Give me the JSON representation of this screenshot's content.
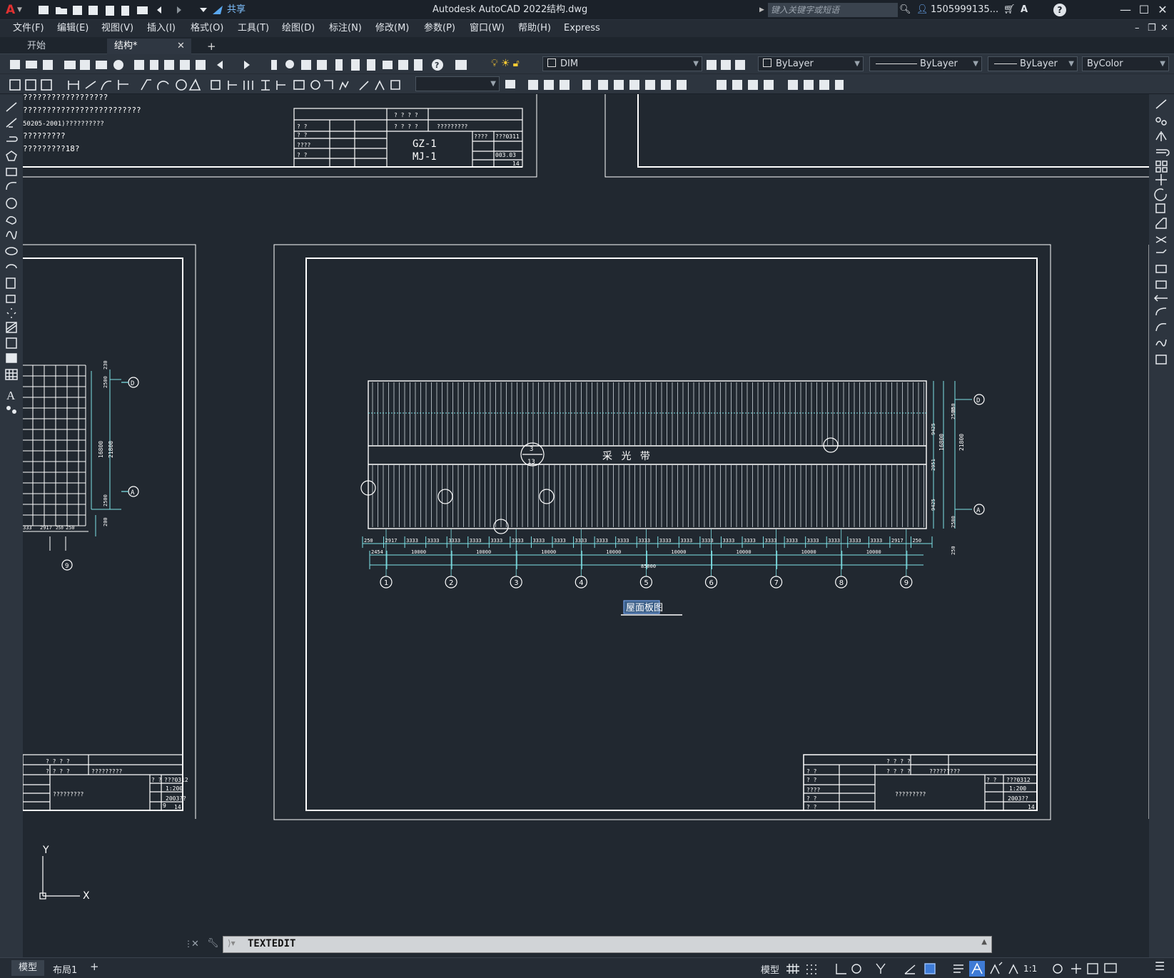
{
  "window": {
    "app_title": "Autodesk AutoCAD 2022",
    "file_name": "结构.dwg",
    "share_label": "共享",
    "search_placeholder": "键入关键字或短语",
    "user": "1505999135...",
    "minimize": "—",
    "maximize": "☐",
    "close": "✕"
  },
  "menu": {
    "items": [
      "文件(F)",
      "编辑(E)",
      "视图(V)",
      "插入(I)",
      "格式(O)",
      "工具(T)",
      "绘图(D)",
      "标注(N)",
      "修改(M)",
      "参数(P)",
      "窗口(W)",
      "帮助(H)",
      "Express"
    ]
  },
  "tabs": {
    "items": [
      "开始",
      "结构*"
    ],
    "close": "✕",
    "add": "+"
  },
  "toolbar": {
    "layer": "DIM",
    "color": "ByLayer",
    "linetype": "ByLayer",
    "lineweight": "ByLayer",
    "plotstyle": "ByColor"
  },
  "drawing": {
    "notes": [
      "??????????????????",
      "?????????????????????????",
      "50205-2001)??????????",
      "?????????",
      "?????????18?"
    ],
    "top_titleblock": {
      "rows": [
        "? ? ? ?",
        "? ? ? ?"
      ],
      "title2": "?????????",
      "codes": [
        "GZ-1",
        "MJ-1"
      ],
      "no1": "???0311",
      "no2": "003.03",
      "sheet": "14",
      "labels": [
        "????",
        "? ?",
        "? ?",
        "? ?"
      ]
    },
    "light_band": "采  光  带",
    "plan_title": "屋面板图",
    "dims_bottom": [
      "250",
      "2917",
      "3333",
      "3333",
      "3333",
      "3333",
      "3333",
      "3333",
      "3333",
      "3333",
      "3333",
      "3333",
      "3333",
      "3333",
      "3333",
      "3333",
      "3333",
      "3333",
      "3333",
      "3333",
      "3333",
      "3333",
      "3333",
      "3333",
      "3333",
      "2917",
      "250"
    ],
    "dims_bays": [
      "2454",
      "10000",
      "10000",
      "10000",
      "10000",
      "10000",
      "10000",
      "10000",
      "10000"
    ],
    "dims_total": "85000",
    "axis_numbers": [
      "1",
      "2",
      "3",
      "4",
      "5",
      "6",
      "7",
      "8",
      "9"
    ],
    "axis_letters": [
      "D",
      "A"
    ],
    "dims_right_outer": [
      "21800"
    ],
    "dims_right_inner": [
      "16800"
    ],
    "dims_right_parts": [
      "250",
      "2500",
      "9425",
      "2951",
      "9425",
      "2500",
      "250"
    ],
    "detail_marks": [
      "3",
      "13"
    ],
    "left_dims": [
      "21800",
      "16800",
      "2500",
      "2500",
      "200",
      "230"
    ],
    "left_dims_bottom": [
      "333",
      "2917",
      "250",
      "250"
    ],
    "left_axis": "9",
    "bottom_titleblock": {
      "rows": [
        "? ? ? ?",
        "? ? ? ?"
      ],
      "title2": "?????????",
      "project": "?????????",
      "no": "???0312",
      "scale": "1:200",
      "date": "2003??",
      "sheet": "14",
      "sheet_no": "9",
      "labels": [
        "? ?",
        "? ?",
        "????",
        "? ?",
        "? ?"
      ]
    }
  },
  "ucs": {
    "x": "X",
    "y": "Y"
  },
  "command": {
    "text": "TEXTEDIT",
    "close": "✕"
  },
  "status": {
    "tabs": [
      "模型",
      "布局1"
    ],
    "add": "+",
    "model": "模型",
    "scale": "1:1"
  }
}
